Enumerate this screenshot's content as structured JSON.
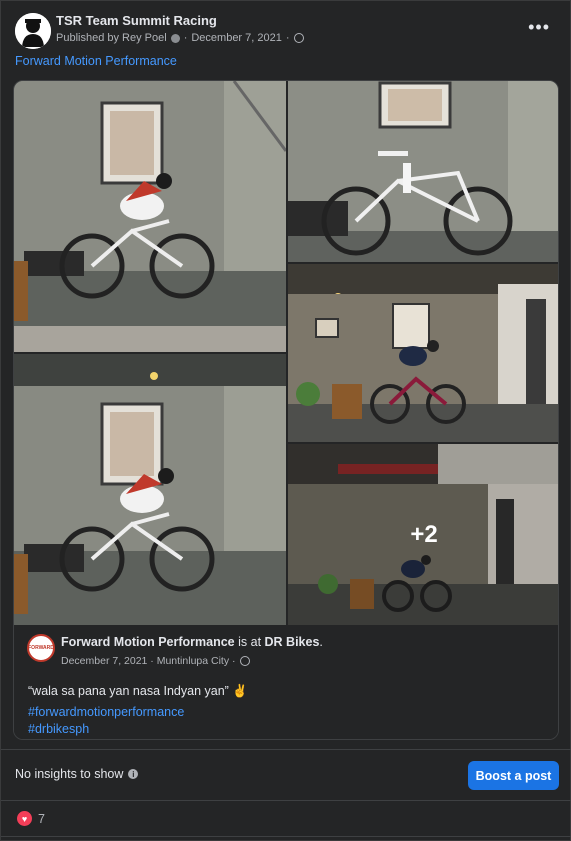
{
  "header": {
    "page_name": "TSR Team Summit Racing",
    "published_by": "Published by Rey Poel",
    "date": "December 7, 2021",
    "more_label": "•••"
  },
  "post": {
    "text": "Forward Motion Performance"
  },
  "photos": {
    "more_count": "+2"
  },
  "shared": {
    "avatar_text": "FORWARD",
    "author": "Forward Motion Performance",
    "is_at": " is at ",
    "place": "DR Bikes",
    "place_suffix": ".",
    "date": "December 7, 2021 · Muntinlupa City ·",
    "text": "“wala sa pana yan nasa Indyan yan” ✌️",
    "hashtags": [
      "#forwardmotionperformance",
      "#drbikesph"
    ]
  },
  "footer": {
    "insights": "No insights to show",
    "boost_label": "Boost a post",
    "reaction_count": "7"
  },
  "colors": {
    "link": "#4599ff",
    "boost": "#1b74e4",
    "heart": "#f33e58"
  }
}
